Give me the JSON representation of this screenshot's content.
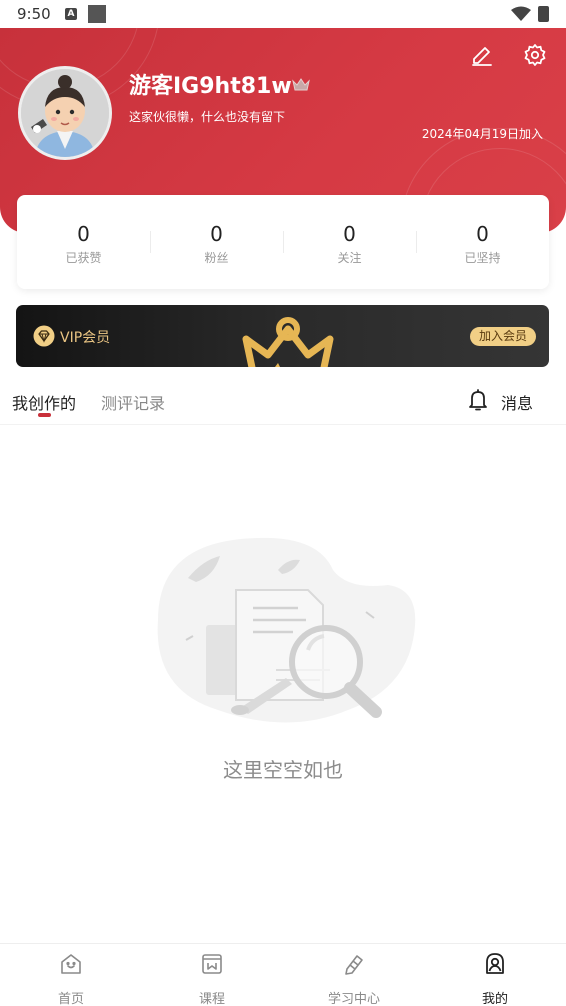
{
  "status_bar": {
    "time": "9:50",
    "notification_badge": "A"
  },
  "profile": {
    "username": "游客IG9ht81w",
    "bio": "这家伙很懒，什么也没有留下",
    "join_date": "2024年04月19日加入"
  },
  "stats": [
    {
      "value": "0",
      "label": "已获赞"
    },
    {
      "value": "0",
      "label": "粉丝"
    },
    {
      "value": "0",
      "label": "关注"
    },
    {
      "value": "0",
      "label": "已坚持"
    }
  ],
  "vip": {
    "label": "VIP会员",
    "join_label": "加入会员"
  },
  "tabs": {
    "created": "我创作的",
    "evaluation": "测评记录",
    "messages": "消息"
  },
  "empty_state": {
    "text": "这里空空如也"
  },
  "bottom_nav": [
    {
      "label": "首页",
      "icon": "home-icon"
    },
    {
      "label": "课程",
      "icon": "course-icon"
    },
    {
      "label": "学习中心",
      "icon": "study-center-icon"
    },
    {
      "label": "我的",
      "icon": "profile-icon",
      "active": true
    }
  ],
  "colors": {
    "brand_red": "#c9303a",
    "vip_gold": "#f1cf86",
    "inactive_gray": "#8a8a8a"
  }
}
